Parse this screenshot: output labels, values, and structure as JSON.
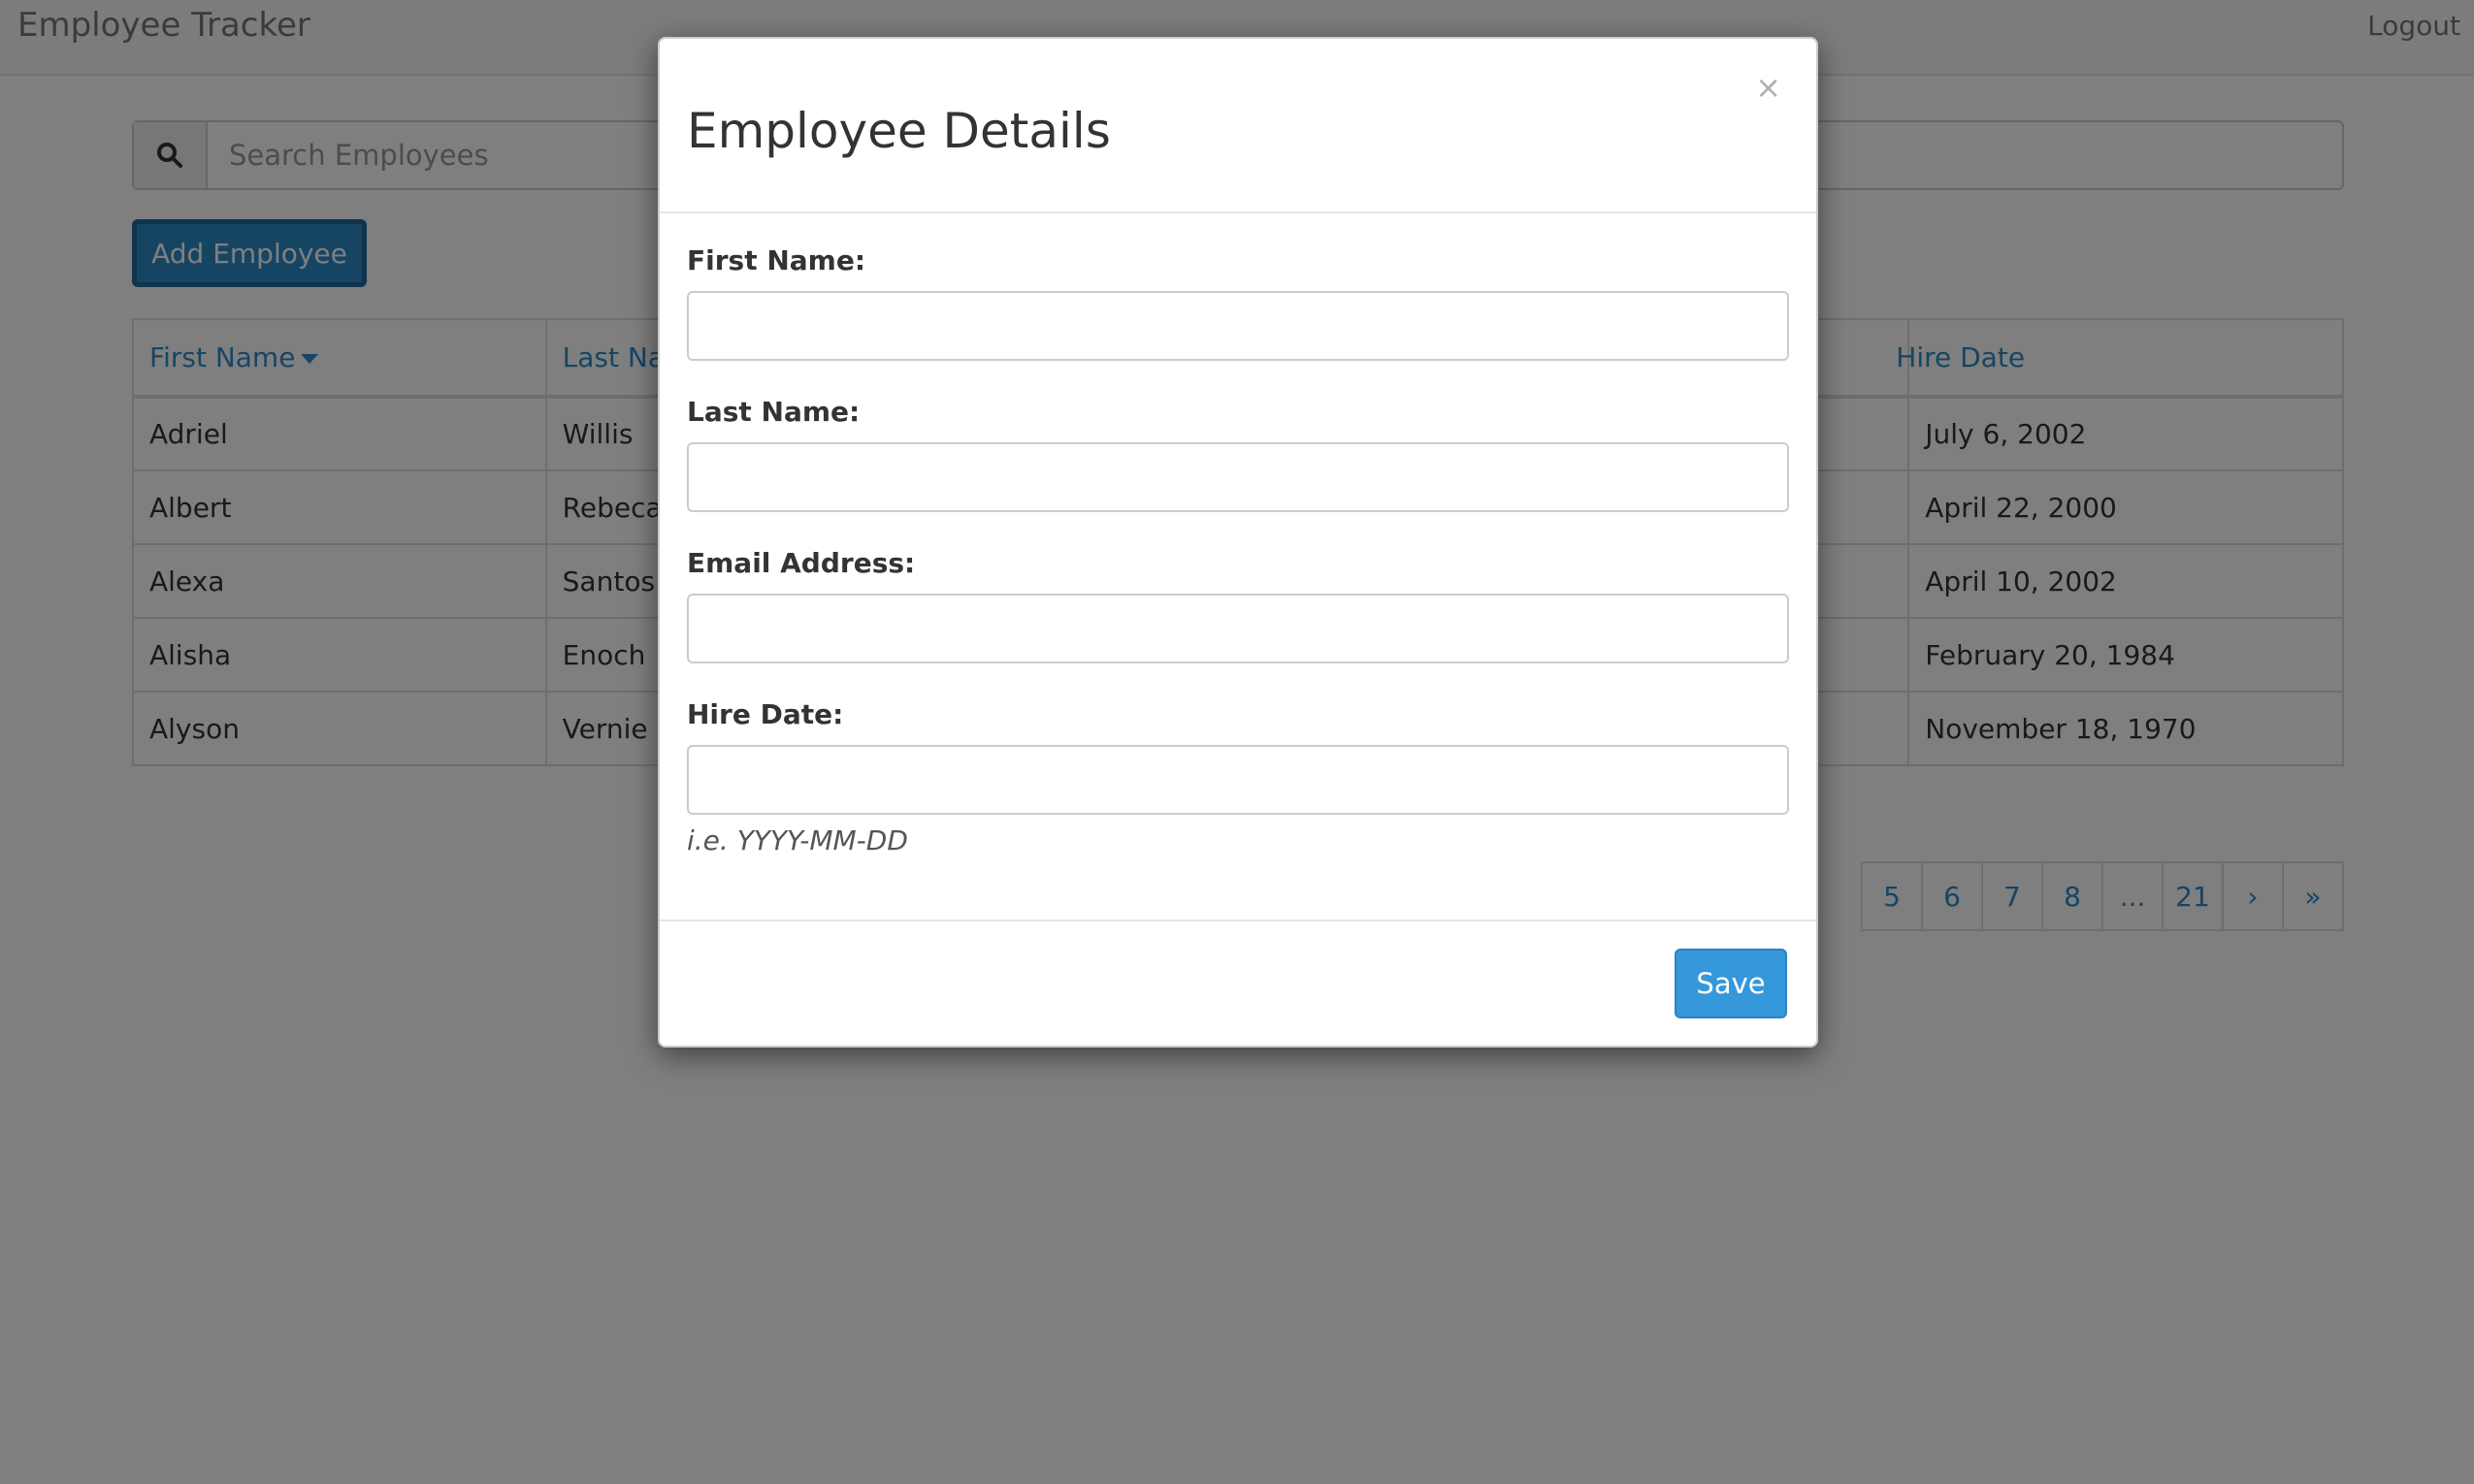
{
  "navbar": {
    "brand": "Employee Tracker",
    "logout": "Logout"
  },
  "search": {
    "placeholder": "Search Employees",
    "icon": "search-icon"
  },
  "add_button": "Add Employee",
  "table": {
    "headers": [
      "First Name",
      "Last Name",
      "",
      "Hire Date"
    ],
    "sort": {
      "column": "First Name",
      "direction": "desc-caret"
    },
    "rows": [
      [
        "Adriel",
        "Willis",
        "",
        "July 6, 2002"
      ],
      [
        "Albert",
        "Rebeca",
        "",
        "April 22, 2000"
      ],
      [
        "Alexa",
        "Santos",
        "",
        "April 10, 2002"
      ],
      [
        "Alisha",
        "Enoch",
        "",
        "February 20, 1984"
      ],
      [
        "Alyson",
        "Vernie",
        "",
        "November 18, 1970"
      ]
    ]
  },
  "pagination": [
    "5",
    "6",
    "7",
    "8",
    "...",
    "21",
    "›",
    "»"
  ],
  "modal": {
    "title": "Employee Details",
    "close": "×",
    "fields": {
      "first_name": {
        "label": "First Name:",
        "value": ""
      },
      "last_name": {
        "label": "Last Name:",
        "value": ""
      },
      "email": {
        "label": "Email Address:",
        "value": ""
      },
      "hire_date": {
        "label": "Hire Date:",
        "value": "",
        "hint": "i.e. YYYY-MM-DD"
      }
    },
    "save": "Save"
  },
  "colors": {
    "accent": "#2c8ac8",
    "save": "#3498db",
    "backdrop": "rgba(0,0,0,0.5)"
  }
}
